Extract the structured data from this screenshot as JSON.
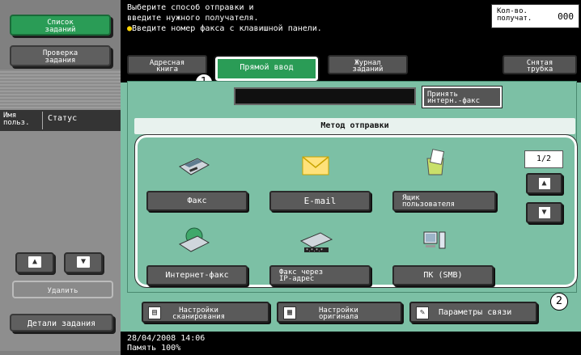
{
  "left_panel": {
    "job_list_label": "Список\nзаданий",
    "job_check_label": "Проверка\nзадания",
    "col_user": "Имя\nпольз.",
    "col_status": "Статус",
    "delete_label": "Удалить",
    "job_details_label": "Детали задания"
  },
  "top": {
    "message_line1": "Выберите способ отправки и",
    "message_line2": "введите нужного получателя.",
    "message_line3": "Введите номер факса с клавишной панели.",
    "recipients_label": "Кол-во.\nполучат.",
    "recipients_value": "000"
  },
  "tabs": {
    "address_book": "Адресная\nкнига",
    "direct_input": "Прямой ввод",
    "job_log": "Журнал\nзаданий",
    "offhook": "Снятая\nтрубка"
  },
  "accept_ifax": "Принять\nинтерн.-факс",
  "method_title": "Метод отправки",
  "methods": {
    "fax": "Факс",
    "email": "E-mail",
    "user_box": "Ящик\nпользователя",
    "ifax": "Интернет-факс",
    "ip_fax": "Факс через\nIP-адрес",
    "pc_smb": "ПК (SMB)"
  },
  "page_indicator": "1/2",
  "bottom": {
    "scan_settings": "Настройки\nсканирования",
    "original_settings": "Настройки\nоригинала",
    "comm_params": "Параметры связи"
  },
  "callouts": {
    "one": "1",
    "two": "2"
  },
  "status": {
    "datetime": "28/04/2008   14:06",
    "memory": "Память     100%"
  },
  "icons": [
    "fax-icon",
    "email-icon",
    "user-box-icon",
    "internet-fax-icon",
    "ip-fax-icon",
    "pc-icon",
    "arrow-up-icon",
    "arrow-down-icon",
    "scan-settings-icon",
    "original-settings-icon",
    "comm-params-icon",
    "lightbulb-icon"
  ],
  "colors": {
    "green": "#2a9c56",
    "panel": "#7cc0a5",
    "dark": "#000000"
  }
}
